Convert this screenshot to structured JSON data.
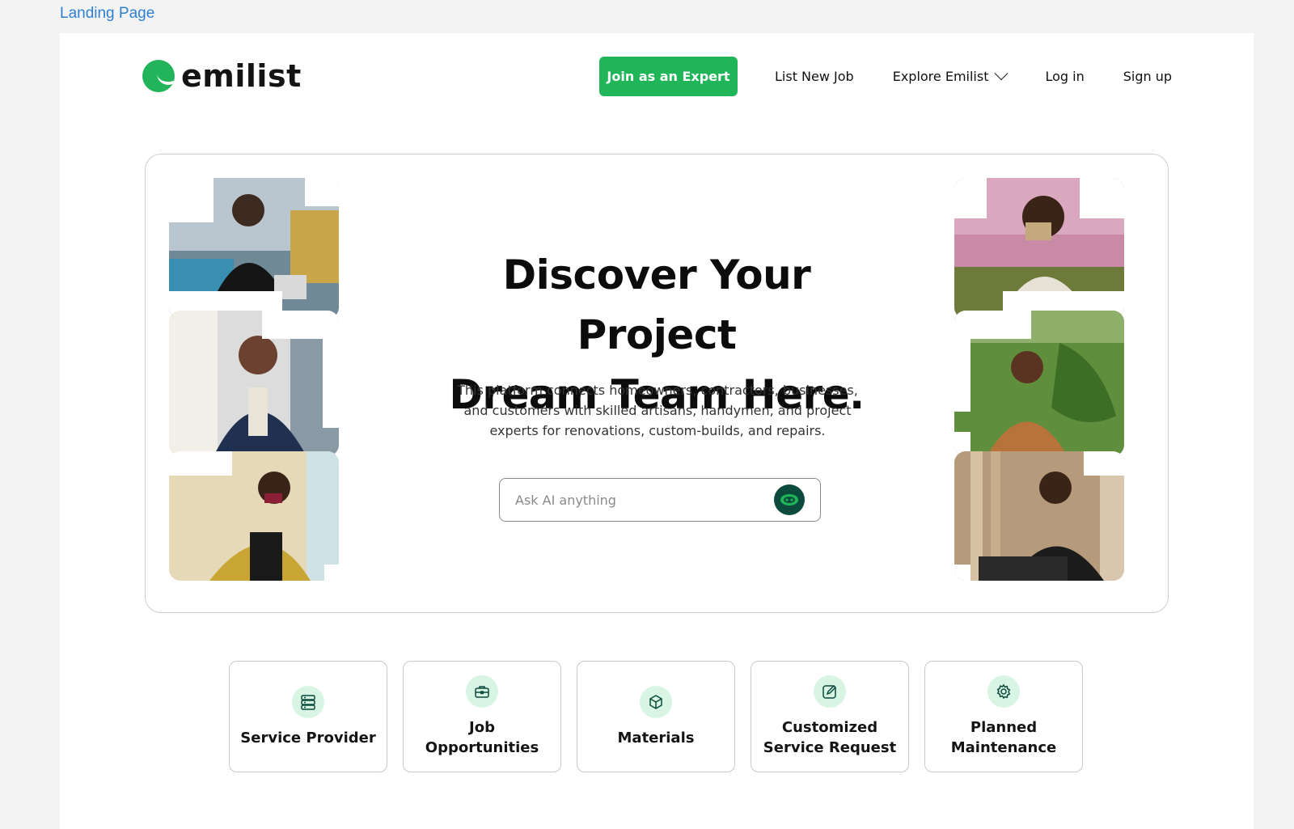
{
  "page_label": "Landing Page",
  "brand": {
    "name": "emilist",
    "color": "#21b55a"
  },
  "nav": {
    "join_label": "Join as an Expert",
    "list_job": "List New Job",
    "explore": "Explore Emilist",
    "login": "Log in",
    "signup": "Sign up"
  },
  "hero": {
    "title_line1": "Discover Your Project",
    "title_line2": "Dream Team Here.",
    "description": "This platform connects homeowners, contractors, businesses, and customers with skilled artisans, handymen, and project experts for renovations, custom-builds, and repairs.",
    "search_placeholder": "Ask AI anything"
  },
  "categories": [
    {
      "label": "Service Provider",
      "icon": "server-icon"
    },
    {
      "label": "Job Opportunities",
      "icon": "briefcase-icon"
    },
    {
      "label": "Materials",
      "icon": "box-icon"
    },
    {
      "label": "Customized Service Request",
      "icon": "edit-pen-icon"
    },
    {
      "label": "Planned Maintenance",
      "icon": "settings-gear-icon"
    }
  ],
  "colors": {
    "accent_green": "#21b55a",
    "dark_green": "#0b4a3c",
    "icon_bg": "#d8f5e3"
  }
}
